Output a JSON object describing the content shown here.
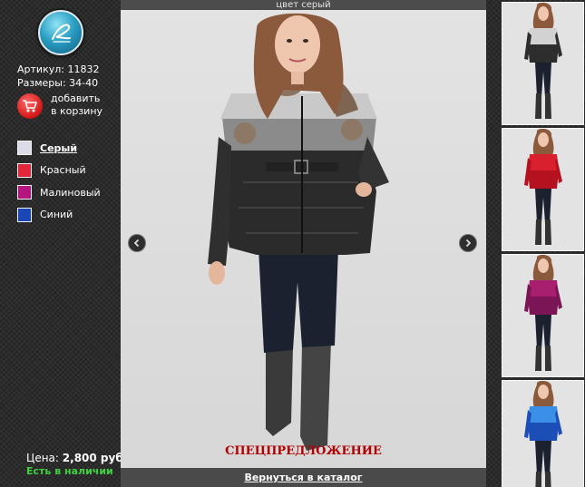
{
  "product": {
    "article": "Артикул: 11832",
    "sizes": "Размеры: 34-40"
  },
  "cart": {
    "label": "добавить\nв корзину",
    "icon": "shopping-cart-icon"
  },
  "colors": [
    {
      "label": "Серый",
      "hex": "#dcdce6",
      "active": true
    },
    {
      "label": "Красный",
      "hex": "#e3273a",
      "active": false
    },
    {
      "label": "Малиновый",
      "hex": "#b3177f",
      "active": false
    },
    {
      "label": "Синий",
      "hex": "#1a46b7",
      "active": false
    }
  ],
  "price": {
    "label": "Цена:",
    "value": "2,800 руб."
  },
  "availability": "Есть в наличии",
  "main": {
    "caption": "цвет серый",
    "special": "СПЕЦПРЕДЛОЖЕНИЕ",
    "back_link": "Вернуться в каталог"
  },
  "thumbnails": [
    {
      "color": "grey",
      "jacket_top": "#d2d2d2",
      "jacket_bottom": "#2d2d2d"
    },
    {
      "color": "red",
      "jacket_top": "#d8202e",
      "jacket_bottom": "#b5121f"
    },
    {
      "color": "magenta",
      "jacket_top": "#a91f70",
      "jacket_bottom": "#7c1555"
    },
    {
      "color": "blue",
      "jacket_top": "#3b8fe6",
      "jacket_bottom": "#1c4eb8"
    }
  ]
}
